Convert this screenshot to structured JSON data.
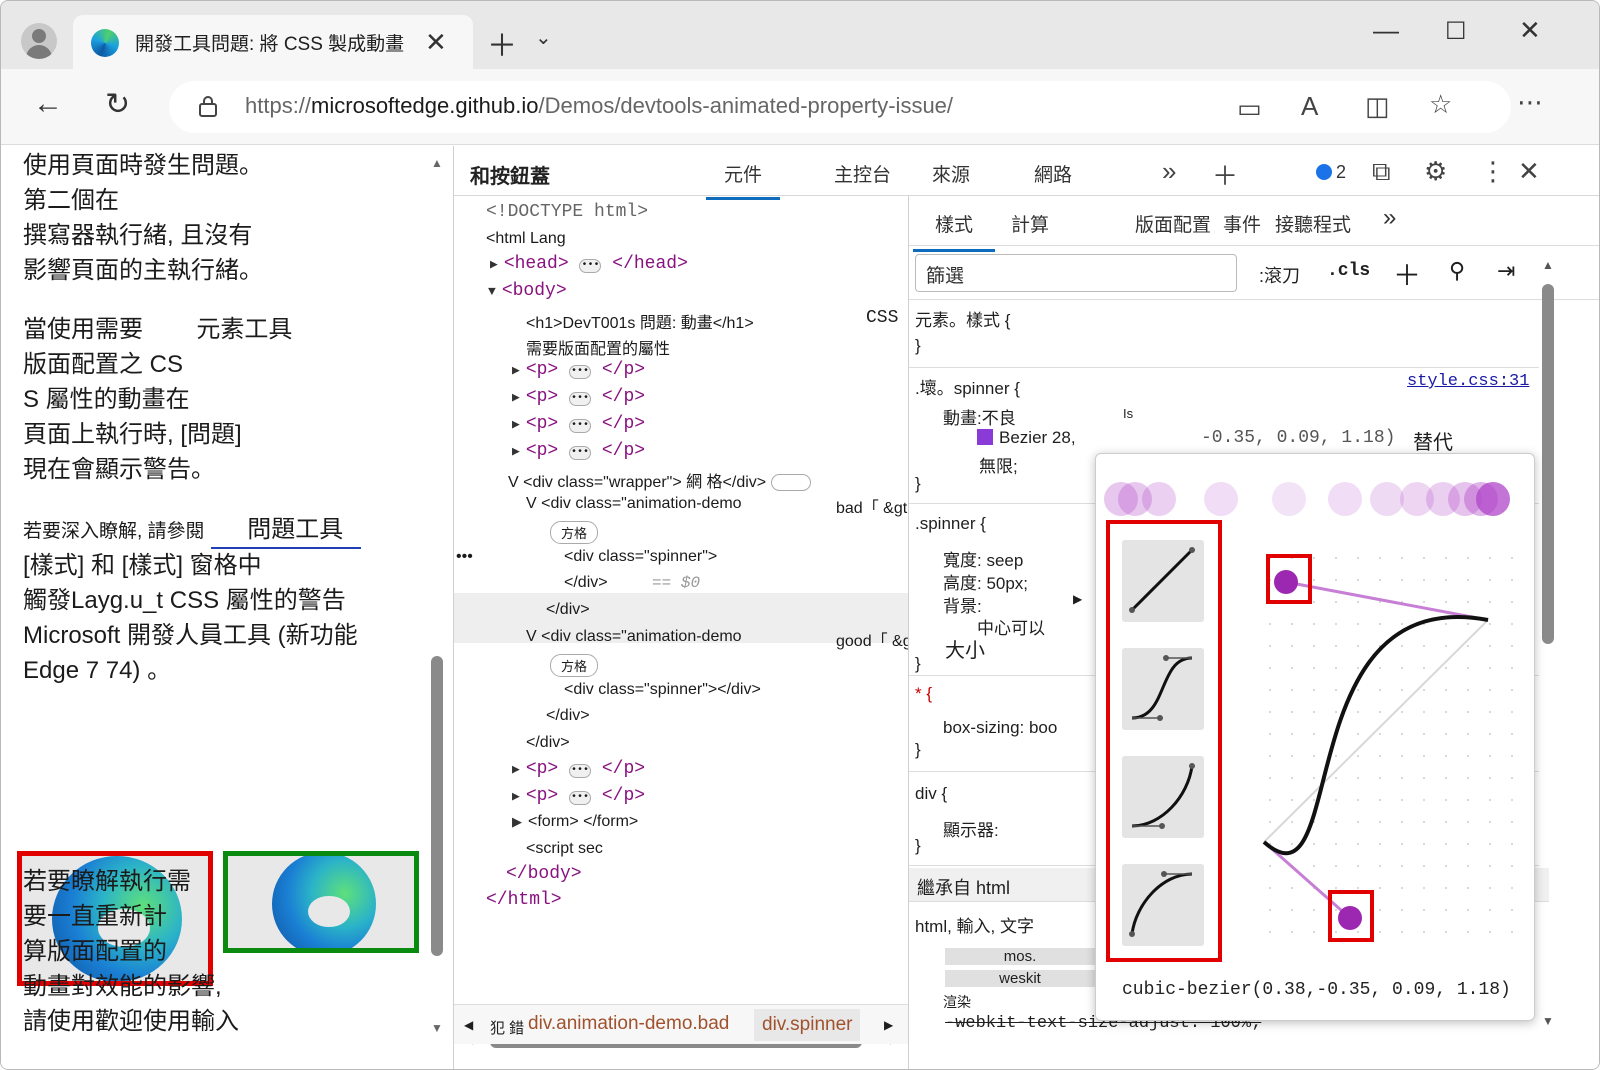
{
  "browser": {
    "tab_title": "開發工具問題: 將 CSS 製成動畫",
    "url_prefix": "https://",
    "url_host": "microsoftedge.github.io",
    "url_path": "/Demos/devtools-animated-property-issue/"
  },
  "page": {
    "para1": [
      "使用頁面時發生問題。",
      "第二個在",
      "撰寫器執行緒, 且沒有",
      "影響頁面的主執行緒。"
    ],
    "para2": [
      "當使用需要        元素工具",
      "版面配置之 CS",
      "S 屬性的動畫在",
      "頁面上執行時, [問題]",
      "現在會顯示警告。"
    ],
    "para3_small": "若要深入瞭解, 請參閱",
    "para3_link": "問題工具",
    "para4": [
      "[樣式] 和 [樣式] 窗格中",
      "觸發Layg.u_t CSS 屬性的警告",
      "Microsoft 開發人員工具 (新功能",
      "Edge 7 74) 。"
    ],
    "para5": [
      "若要瞭解執行需",
      "要一直重新計",
      "算版面配置的",
      "動畫對效能的影響,",
      "請使用歡迎使用輸入"
    ]
  },
  "devtools": {
    "title": "和按鈕蓋",
    "tabs": [
      "元件",
      "主控台",
      "來源",
      "網路"
    ],
    "issues_count": "2",
    "elements": {
      "doctype": "<!DOCTYPE html>",
      "html_open": "<html Lang",
      "head": "<head>",
      "head_close": "</head>",
      "body": "<body>",
      "h1": "<h1>DevT001s 問題: 動畫</h1>",
      "h1_side": "CSS",
      "h1_line2": "需要版面配置的屬性",
      "p_open": "<p>",
      "p_close": "</p>",
      "wrapper": "V <div class=\"wrapper\"> 網 格</div>",
      "demo_bad": "V <div class=\"animation-demo",
      "demo_bad_side": "bad「 &gt;",
      "grid_pill": "方格",
      "spinner_selected": "<div class=\"spinner\">",
      "div_close": "</div>",
      "dollar0": "== $0",
      "demo_good": "V <div class=\"animation-demo",
      "demo_good_side": "good「 &gt;",
      "spinner_good": "<div class=\"spinner\"></div>",
      "form": "<form> </form>",
      "script": "<script sec",
      "body_close": "</body>",
      "html_close": "</html>"
    },
    "breadcrumb": [
      "犯 錯",
      "div.animation-demo.bad",
      "div.spinner"
    ],
    "styles": {
      "tabs": [
        "樣式",
        "計算",
        "版面配置",
        "事件",
        "接聽程式"
      ],
      "filter_placeholder": "篩選",
      "hov": ":滾刀",
      "cls": ".cls",
      "element_style": "元素。樣式 {",
      "rule1_selector": ".壞。spinner {",
      "rule1_source": "style.css:31",
      "rule1_prop": "動畫:不良",
      "rule1_is": "Is",
      "rule1_bezier": "Bezier 28,",
      "rule1_values": "-0.35, 0.09, 1.18)",
      "rule1_replace": "替代",
      "rule1_infinite": "無限;",
      "rule2_selector": ".spinner {",
      "rule2_width": "寬度: seep",
      "rule2_height": "高度: 50px;",
      "rule2_bg": "背景:",
      "rule2_center": "中心可以",
      "rule2_size": "大小",
      "rule3_selector": "* {",
      "rule3_prop": "box-sizing:  boo",
      "rule4_selector": "div {",
      "rule4_prop": "顯示器:",
      "inherited": "繼承自 html",
      "rule5_selector": "html,  輸入,  文字",
      "rule5_mos": "mos.",
      "rule5_webkit": "weskit",
      "rule5_render": "渲染",
      "rule5_strike": "-webkit-text-size-adjust: 100%;",
      "close_brace": "}"
    },
    "bezier": {
      "value": "cubic-bezier(0.38,-0.35, 0.09, 1.18)"
    }
  },
  "colors": {
    "accent": "#0f6cbd",
    "highlight_red": "#e00000",
    "highlight_green": "#0b8a10",
    "bezier_purple": "#9c27b0"
  }
}
